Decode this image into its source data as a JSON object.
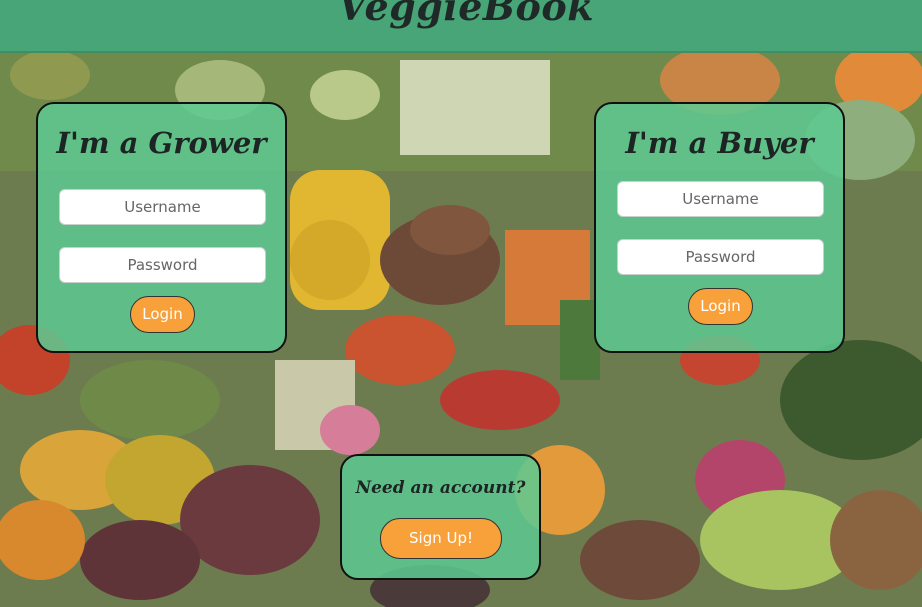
{
  "header": {
    "brand": "VeggieBook"
  },
  "grower": {
    "title": "I'm a Grower",
    "username_placeholder": "Username",
    "password_placeholder": "Password",
    "login_label": "Login"
  },
  "buyer": {
    "title": "I'm a Buyer",
    "username_placeholder": "Username",
    "password_placeholder": "Password",
    "login_label": "Login"
  },
  "signup": {
    "prompt": "Need an account?",
    "button_label": "Sign Up!"
  },
  "colors": {
    "header": "#48a577",
    "card": "#5dc992",
    "button": "#f8a03a",
    "text_dark": "#1c2523"
  }
}
